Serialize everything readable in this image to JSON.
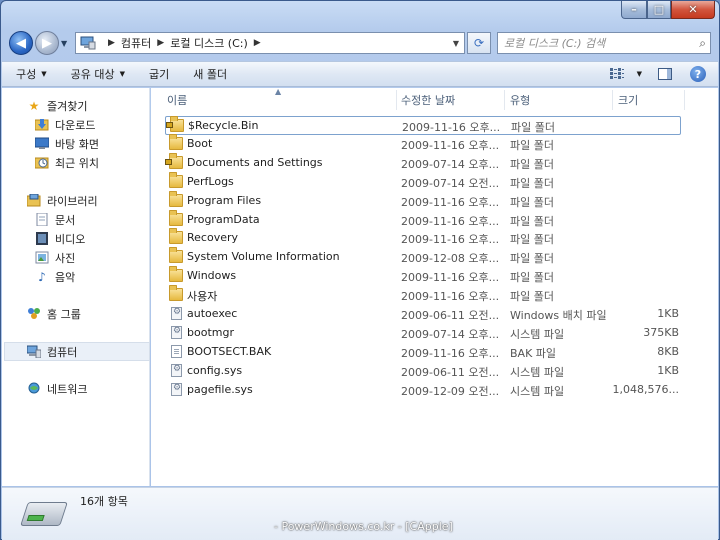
{
  "window": {
    "caption_buttons": {
      "minimize_icon": "minimize-icon",
      "maximize_icon": "maximize-icon",
      "close_icon": "close-icon"
    }
  },
  "address": {
    "breadcrumbs": [
      "컴퓨터",
      "로컬 디스크 (C:)"
    ],
    "search_placeholder": "로컬 디스크 (C:) 검색"
  },
  "toolbar": {
    "organize": "구성",
    "share": "공유 대상",
    "burn": "굽기",
    "new_folder": "새 폴더"
  },
  "sidebar": {
    "favorites": {
      "label": "즐겨찾기",
      "items": [
        "다운로드",
        "바탕 화면",
        "최근 위치"
      ]
    },
    "libraries": {
      "label": "라이브러리",
      "items": [
        "문서",
        "비디오",
        "사진",
        "음악"
      ]
    },
    "homegroup": "홈 그룹",
    "computer": "컴퓨터",
    "network": "네트워크"
  },
  "columns": {
    "name": "이름",
    "date": "수정한 날짜",
    "type": "유형",
    "size": "크기"
  },
  "files": [
    {
      "name": "$Recycle.Bin",
      "date": "2009-11-16 오후...",
      "type": "파일 폴더",
      "size": "",
      "icon": "locked-folder"
    },
    {
      "name": "Boot",
      "date": "2009-11-16 오후...",
      "type": "파일 폴더",
      "size": "",
      "icon": "folder"
    },
    {
      "name": "Documents and Settings",
      "date": "2009-07-14 오후...",
      "type": "파일 폴더",
      "size": "",
      "icon": "locked-folder"
    },
    {
      "name": "PerfLogs",
      "date": "2009-07-14 오전...",
      "type": "파일 폴더",
      "size": "",
      "icon": "folder"
    },
    {
      "name": "Program Files",
      "date": "2009-11-16 오후...",
      "type": "파일 폴더",
      "size": "",
      "icon": "folder"
    },
    {
      "name": "ProgramData",
      "date": "2009-11-16 오후...",
      "type": "파일 폴더",
      "size": "",
      "icon": "folder"
    },
    {
      "name": "Recovery",
      "date": "2009-11-16 오후...",
      "type": "파일 폴더",
      "size": "",
      "icon": "folder"
    },
    {
      "name": "System Volume Information",
      "date": "2009-12-08 오후...",
      "type": "파일 폴더",
      "size": "",
      "icon": "folder"
    },
    {
      "name": "Windows",
      "date": "2009-11-16 오후...",
      "type": "파일 폴더",
      "size": "",
      "icon": "folder"
    },
    {
      "name": "사용자",
      "date": "2009-11-16 오후...",
      "type": "파일 폴더",
      "size": "",
      "icon": "folder"
    },
    {
      "name": "autoexec",
      "date": "2009-06-11 오전...",
      "type": "Windows 배치 파일",
      "size": "1KB",
      "icon": "settings-file"
    },
    {
      "name": "bootmgr",
      "date": "2009-07-14 오후...",
      "type": "시스템 파일",
      "size": "375KB",
      "icon": "settings-file"
    },
    {
      "name": "BOOTSECT.BAK",
      "date": "2009-11-16 오후...",
      "type": "BAK 파일",
      "size": "8KB",
      "icon": "document"
    },
    {
      "name": "config.sys",
      "date": "2009-06-11 오전...",
      "type": "시스템 파일",
      "size": "1KB",
      "icon": "settings-file"
    },
    {
      "name": "pagefile.sys",
      "date": "2009-12-09 오전...",
      "type": "시스템 파일",
      "size": "1,048,576...",
      "icon": "settings-file"
    }
  ],
  "details": {
    "count": "16개 항목"
  },
  "watermark": "- PowerWindows.co.kr - [CApple]"
}
